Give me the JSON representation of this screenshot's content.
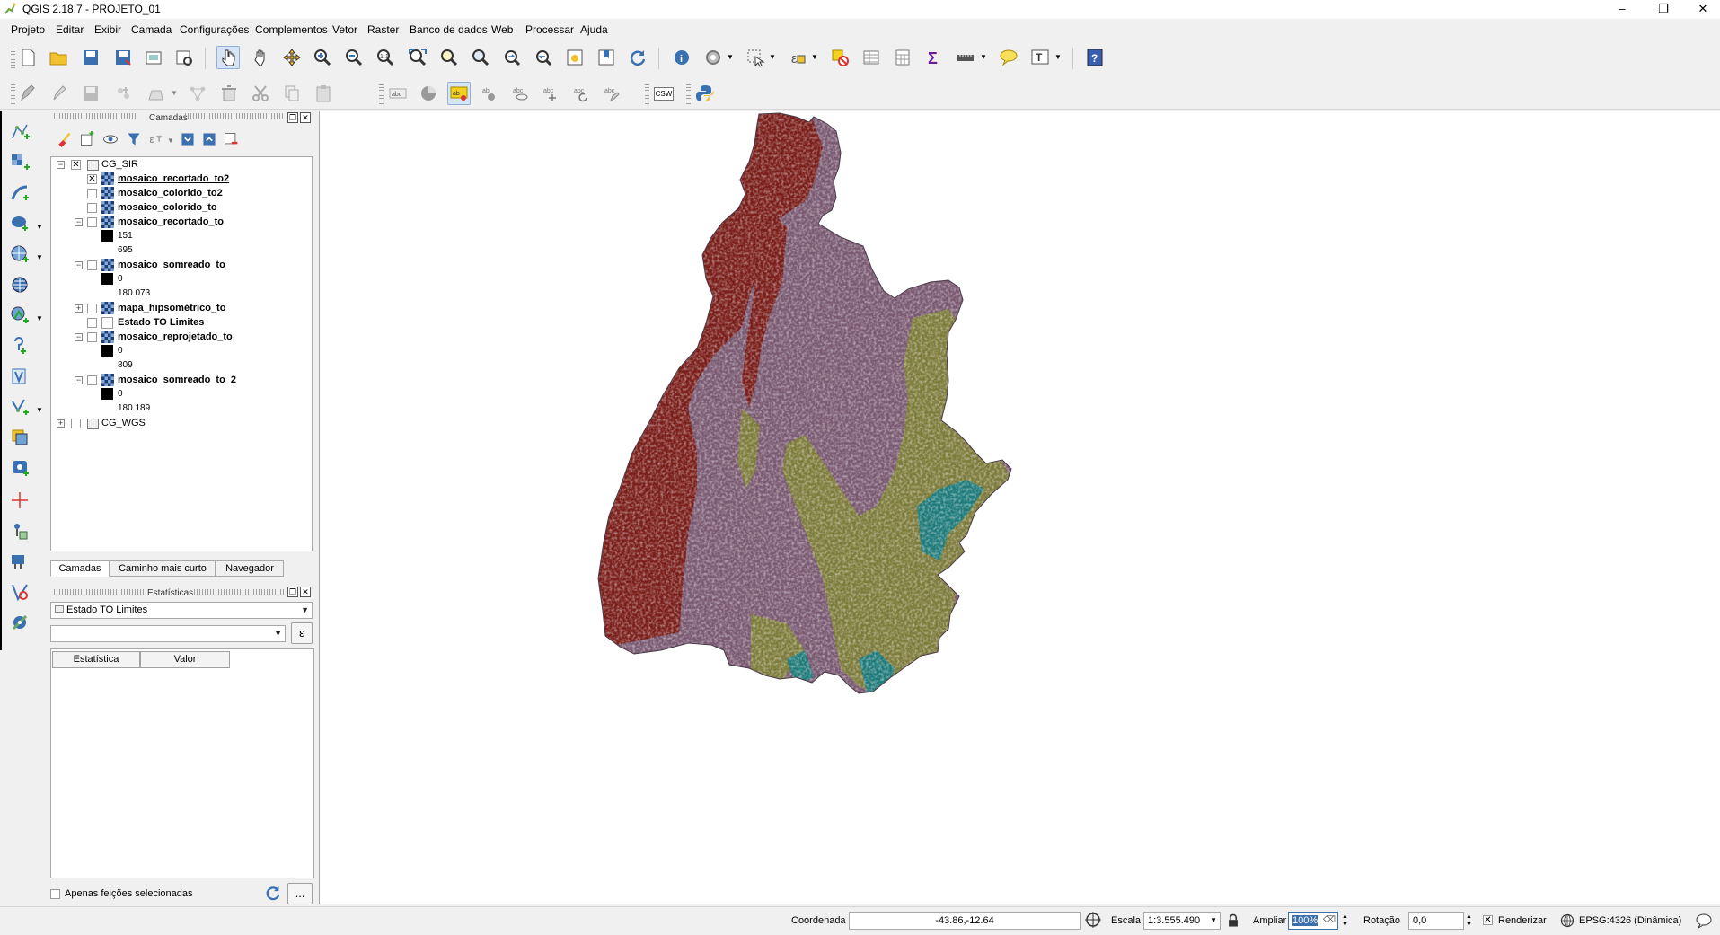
{
  "window": {
    "title": "QGIS 2.18.7 - PROJETO_01",
    "minimize": "–",
    "restore": "❐",
    "close": "✕"
  },
  "menu": [
    "Projeto",
    "Editar",
    "Exibir",
    "Camada",
    "Configurações",
    "Complementos",
    "Vetor",
    "Raster",
    "Banco de dados",
    "Web",
    "Processar",
    "Ajuda"
  ],
  "layers_panel": {
    "title": "Camadas",
    "groups": {
      "cg_sir": "CG_SIR",
      "cg_wgs": "CG_WGS"
    },
    "layers": [
      {
        "name": "mosaico_recortado_to2",
        "checked": true
      },
      {
        "name": "mosaico_colorido_to2"
      },
      {
        "name": "mosaico_colorido_to"
      },
      {
        "name": "mosaico_recortado_to",
        "legend": [
          "151",
          "695"
        ]
      },
      {
        "name": "mosaico_somreado_to",
        "legend": [
          "0",
          "180.073"
        ]
      },
      {
        "name": "mapa_hipsométrico_to"
      },
      {
        "name": "Estado TO Limites"
      },
      {
        "name": "mosaico_reprojetado_to",
        "legend": [
          "0",
          "809"
        ]
      },
      {
        "name": "mosaico_somreado_to_2",
        "legend": [
          "0",
          "180.189"
        ]
      }
    ]
  },
  "tabs": [
    "Camadas",
    "Caminho mais curto",
    "Navegador"
  ],
  "stats_panel": {
    "title": "Estatísticas",
    "layer_select": "Estado TO Limites",
    "field_select": "",
    "expression_button": "ε",
    "columns": [
      "Estatística",
      "Valor"
    ],
    "selected_only_label": "Apenas feições selecionadas",
    "more_button": "..."
  },
  "toolbar2": {
    "csw_label": "CSW"
  },
  "status": {
    "coord_label": "Coordenada",
    "coord_value": "-43.86,-12.64",
    "scale_label": "Escala",
    "scale_value": "1:3.555.490",
    "magnify_label": "Ampliar",
    "magnify_value": "100%",
    "rotation_label": "Rotação",
    "rotation_value": "0,0",
    "render_label": "Renderizar",
    "render_checked": true,
    "crs_label": "EPSG:4326 (Dinâmica)"
  },
  "map": {
    "colors": {
      "west": "#7a1e1a",
      "center": "#7a5a72",
      "east": "#7d7b3a",
      "water": "#1f7a7a"
    }
  }
}
